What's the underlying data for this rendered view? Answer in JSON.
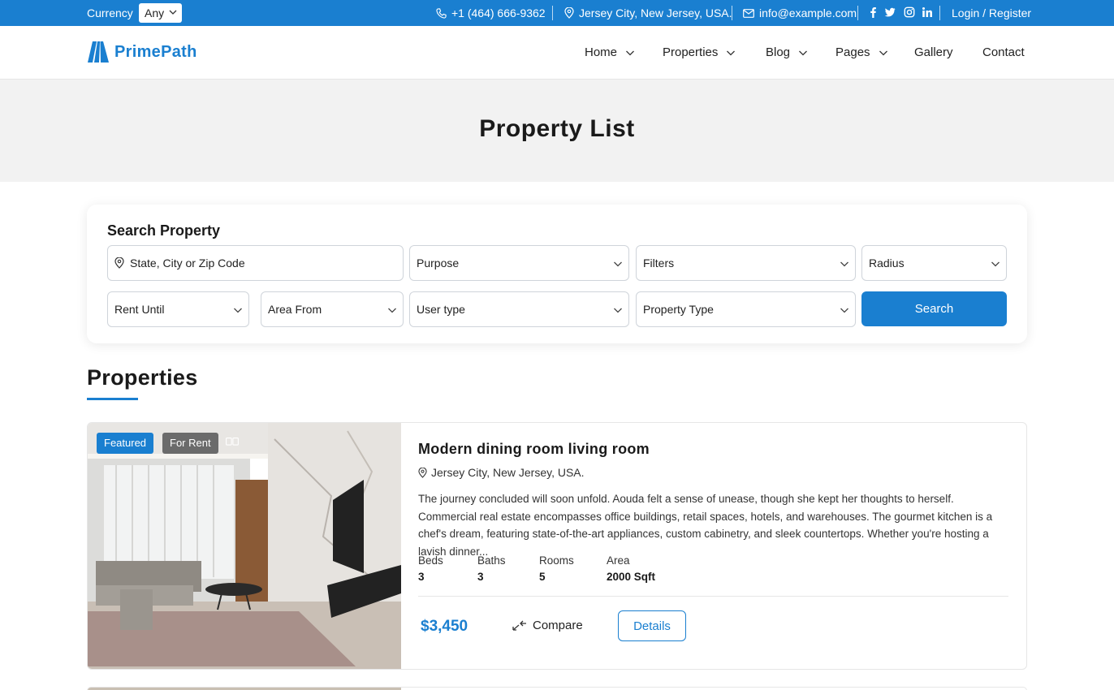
{
  "colors": {
    "brand": "#1a7fd0",
    "badge_featured": "#1a7fd0",
    "badge_rent": "#6b6b6b"
  },
  "topbar": {
    "currency_label": "Currency",
    "currency_value": "Any",
    "phone": "+1 (464) 666-9362",
    "address": "Jersey City, New Jersey, USA.",
    "email": "info@example.com",
    "social_icons": [
      "facebook-icon",
      "twitter-icon",
      "instagram-icon",
      "linkedin-icon"
    ],
    "login": "Login / Register"
  },
  "header": {
    "logo_text": "PrimePath",
    "nav": [
      {
        "label": "Home",
        "dropdown": true
      },
      {
        "label": "Properties",
        "dropdown": true
      },
      {
        "label": "Blog",
        "dropdown": true
      },
      {
        "label": "Pages",
        "dropdown": true
      },
      {
        "label": "Gallery",
        "dropdown": false
      },
      {
        "label": "Contact",
        "dropdown": false
      }
    ]
  },
  "banner": {
    "title": "Property List"
  },
  "search": {
    "heading": "Search Property",
    "location_placeholder": "State, City or Zip Code",
    "purpose": "Purpose",
    "filters": "Filters",
    "radius": "Radius",
    "rent_until": "Rent Until",
    "area_from": "Area From",
    "user_type": "User type",
    "property_type": "Property Type",
    "button": "Search"
  },
  "properties": {
    "heading": "Properties",
    "items": [
      {
        "badge_featured": "Featured",
        "badge_status": "For Rent",
        "title": "Modern dining room living room",
        "location": "Jersey City, New Jersey, USA.",
        "description": "The journey concluded will soon unfold. Aouda felt a sense of unease, though she kept her thoughts to herself. Commercial real estate encompasses office buildings, retail spaces, hotels, and warehouses. The gourmet kitchen is a chef's dream, featuring state-of-the-art appliances, custom cabinetry, and sleek countertops. Whether you're hosting a lavish dinner...",
        "stats": {
          "beds_label": "Beds",
          "beds": "3",
          "baths_label": "Baths",
          "baths": "3",
          "rooms_label": "Rooms",
          "rooms": "5",
          "area_label": "Area",
          "area": "2000 Sqft"
        },
        "price": "$3,450",
        "compare": "Compare",
        "details": "Details"
      }
    ]
  }
}
